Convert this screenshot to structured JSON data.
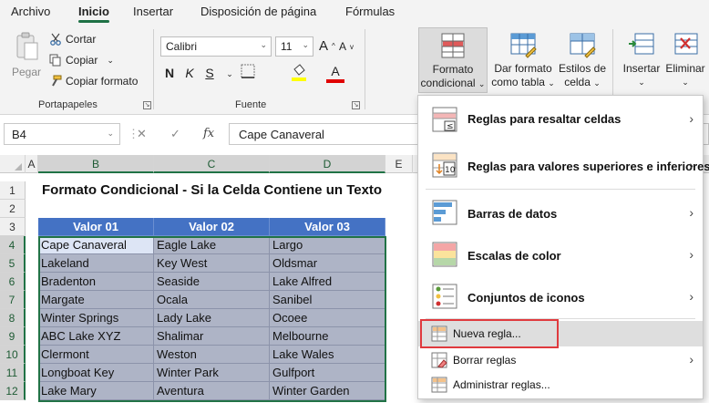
{
  "menubar": {
    "tabs": [
      {
        "label": "Archivo"
      },
      {
        "label": "Inicio"
      },
      {
        "label": "Insertar"
      },
      {
        "label": "Disposición de página"
      },
      {
        "label": "Fórmulas"
      }
    ]
  },
  "ribbon": {
    "clipboard": {
      "paste": "Pegar",
      "cut": "Cortar",
      "copy": "Copiar",
      "format_painter": "Copiar formato",
      "group": "Portapapeles"
    },
    "font": {
      "name": "Calibri",
      "size": "11",
      "grow": "A",
      "shrink": "A",
      "bold": "N",
      "italic": "K",
      "underline": "S",
      "font_color_letter": "A",
      "group": "Fuente"
    },
    "styles": {
      "conditional_line1": "Formato",
      "conditional_line2": "condicional",
      "table_line1": "Dar formato",
      "table_line2": "como tabla",
      "cell_line1": "Estilos de",
      "cell_line2": "celda"
    },
    "cells": {
      "insert": "Insertar",
      "delete": "Eliminar"
    },
    "colors": {
      "highlight": "#ffff00",
      "font_color": "#e00000"
    }
  },
  "formula_bar": {
    "name_box": "B4",
    "cancel": "✕",
    "enter": "✓",
    "fx": "fx",
    "value": "Cape Canaveral"
  },
  "grid": {
    "columns": [
      "A",
      "B",
      "C",
      "D",
      "E"
    ],
    "rows": [
      "1",
      "2",
      "3",
      "4",
      "5",
      "6",
      "7",
      "8",
      "9",
      "10",
      "11",
      "12"
    ],
    "title": "Formato Condicional - Si la Celda Contiene un Texto",
    "headers": [
      "Valor 01",
      "Valor 02",
      "Valor 03"
    ],
    "data": [
      [
        "Cape Canaveral",
        "Eagle Lake",
        "Largo"
      ],
      [
        "Lakeland",
        "Key West",
        "Oldsmar"
      ],
      [
        "Bradenton",
        "Seaside",
        "Lake Alfred"
      ],
      [
        "Margate",
        "Ocala",
        "Sanibel"
      ],
      [
        "Winter Springs",
        "Lady Lake",
        "Ocoee"
      ],
      [
        "ABC Lake XYZ",
        "Shalimar",
        "Melbourne"
      ],
      [
        "Clermont",
        "Weston",
        "Lake Wales"
      ],
      [
        "Longboat Key",
        "Winter Park",
        "Gulfport"
      ],
      [
        "Lake Mary",
        "Aventura",
        "Winter Garden"
      ]
    ],
    "colors": {
      "header": "#4472c4",
      "data": "#aeb4c6",
      "selection": "#217346"
    }
  },
  "cf_menu": {
    "items": [
      {
        "label": "Reglas para resaltar celdas"
      },
      {
        "label": "Reglas para valores superiores e inferiores"
      },
      {
        "label": "Barras de datos"
      },
      {
        "label": "Escalas de color"
      },
      {
        "label": "Conjuntos de iconos"
      }
    ],
    "new_rule": "Nueva regla...",
    "clear_rules": "Borrar reglas",
    "manage_rules": "Administrar reglas...",
    "highlight_color": "#e03a3e"
  }
}
